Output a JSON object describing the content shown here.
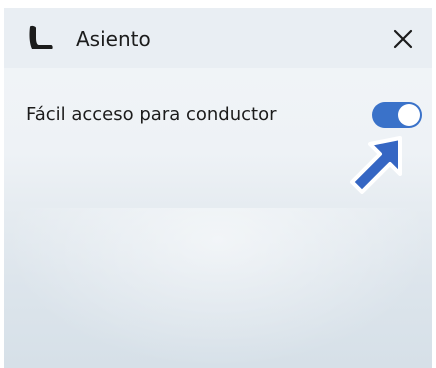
{
  "header": {
    "title": "Asiento",
    "seat_icon": "seat-icon",
    "close_icon": "close-icon"
  },
  "settings": {
    "easy_access_label": "Fácil acceso para conductor",
    "easy_access_enabled": true
  },
  "annotation": {
    "pointer_icon": "arrow-pointer-icon"
  },
  "colors": {
    "toggle_on": "#3a72c9",
    "arrow": "#3566c3"
  }
}
